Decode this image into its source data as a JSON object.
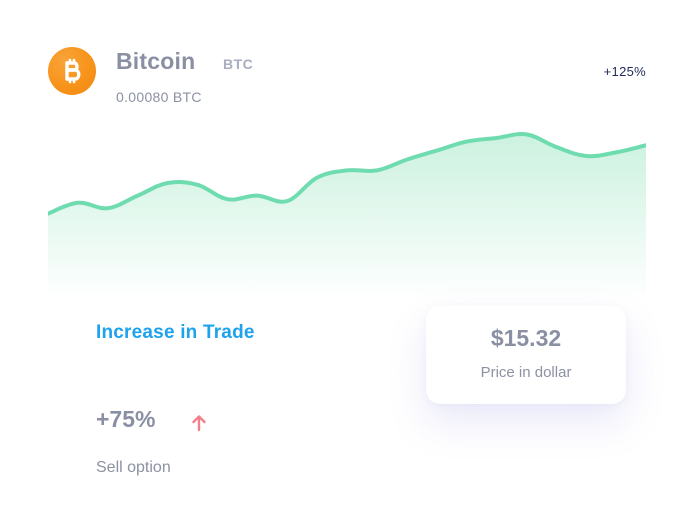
{
  "coin": {
    "name": "Bitcoin",
    "symbol": "BTC",
    "amount": "0.00080 BTC",
    "change": "+125%",
    "icon": "bitcoin-icon"
  },
  "chart_data": {
    "type": "area",
    "x": [
      0,
      1,
      2,
      3,
      4,
      5,
      6,
      7,
      8,
      9,
      10,
      11,
      12,
      13,
      14,
      15,
      16,
      17,
      18,
      19,
      20
    ],
    "y": [
      18,
      24,
      21,
      28,
      35,
      34,
      26,
      28,
      25,
      38,
      42,
      42,
      48,
      53,
      58,
      60,
      62,
      55,
      50,
      52,
      56
    ],
    "line_color": "#6fdcb0",
    "fill_top": "#c9f1de",
    "fill_bottom": "#ffffff",
    "ylim": [
      -30,
      70
    ],
    "grid": false,
    "legend": false
  },
  "trade": {
    "title": "Increase in Trade",
    "percent": "+75%",
    "trend_icon": "arrow-up-icon",
    "trend_color": "#f47f8a",
    "sell_label": "Sell option"
  },
  "price": {
    "value": "$15.32",
    "label": "Price in dollar"
  },
  "colors": {
    "accent": "#1ea2ee",
    "bitcoin": "#f7931a",
    "muted_text": "#8a8fa3",
    "dark_text": "#1e2a5a"
  }
}
